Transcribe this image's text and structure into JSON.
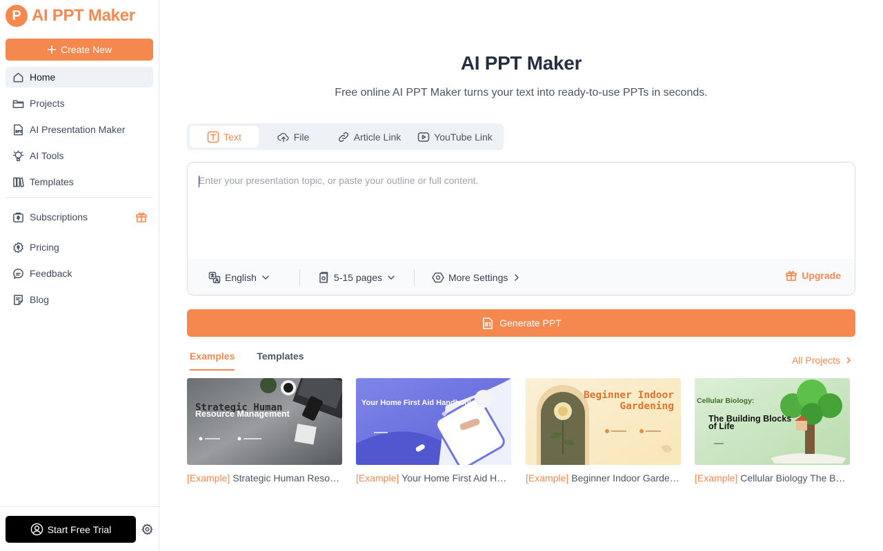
{
  "app": {
    "logo_letter": "P",
    "name": "AI PPT Maker",
    "brand_color": "#f5884f"
  },
  "sidebar": {
    "create_label": "Create New",
    "items": [
      {
        "label": "Home",
        "icon": "home-icon",
        "active": true
      },
      {
        "label": "Projects",
        "icon": "folder-icon"
      },
      {
        "label": "AI Presentation Maker",
        "icon": "ppt-icon"
      },
      {
        "label": "AI Tools",
        "icon": "ai-tools-icon"
      },
      {
        "label": "Templates",
        "icon": "templates-icon"
      },
      {
        "label": "Subscriptions",
        "icon": "subscriptions-icon",
        "badge": "gift-icon"
      },
      {
        "label": "Pricing",
        "icon": "pricing-icon"
      },
      {
        "label": "Feedback",
        "icon": "feedback-icon"
      },
      {
        "label": "Blog",
        "icon": "blog-icon"
      }
    ],
    "trial_label": "Start Free Trial"
  },
  "main": {
    "title": "AI PPT Maker",
    "subtitle": "Free online AI PPT Maker turns your text into ready-to-use PPTs in seconds.",
    "input_tabs": [
      {
        "label": "Text",
        "icon": "text-icon",
        "active": true
      },
      {
        "label": "File",
        "icon": "cloud-upload-icon"
      },
      {
        "label": "Article Link",
        "icon": "link-icon"
      },
      {
        "label": "YouTube Link",
        "icon": "youtube-icon"
      }
    ],
    "editor": {
      "placeholder": "Enter your presentation topic, or paste your outline or full content.",
      "value": ""
    },
    "options": {
      "language": "English",
      "pages": "5-15 pages",
      "more": "More Settings",
      "upgrade": "Upgrade"
    },
    "generate_label": "Generate PPT",
    "section_tabs": [
      {
        "label": "Examples",
        "active": true
      },
      {
        "label": "Templates"
      }
    ],
    "all_projects": "All Projects",
    "examples": [
      {
        "tag": "[Example]",
        "title": "Strategic Human Resource Management",
        "thumb_title_1": "Strategic Human",
        "thumb_title_2": "Resource Management"
      },
      {
        "tag": "[Example]",
        "title": "Your Home First Aid Handbook",
        "thumb_title_1": "Your Home First Aid Handbook"
      },
      {
        "tag": "[Example]",
        "title": "Beginner Indoor Gardening",
        "thumb_title_1": "Beginner Indoor",
        "thumb_title_2": "Gardening"
      },
      {
        "tag": "[Example]",
        "title": "Cellular Biology The Building Blocks of Life",
        "thumb_title_1": "Cellular Biology:",
        "thumb_title_2": "The Building Blocks",
        "thumb_title_3": "of Life"
      }
    ]
  }
}
